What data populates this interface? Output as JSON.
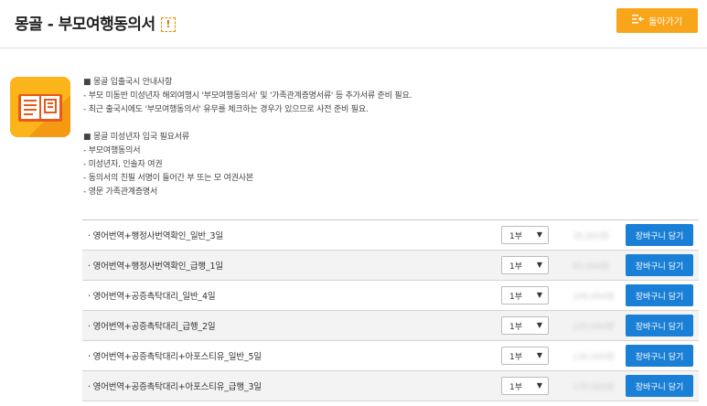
{
  "header": {
    "title": "몽골 - 부모여행동의서",
    "alert_symbol": "!",
    "back_button_label": "돌아가기"
  },
  "notice": {
    "lines_a": [
      "■ 몽골 입출국시 안내사항",
      "- 부모 미동반 미성년자 해외여행시 '부모여행동의서' 및 '가족관계증명서류' 등 추가서류 준비 필요.",
      "- 최근 출국시에도 '부모여행동의서' 유무를 체크하는 경우가 있으므로 사전 준비 필요."
    ],
    "lines_b": [
      "■ 몽골 미성년자 입국 필요서류",
      "- 부모여행동의서",
      "- 미성년자, 인솔자 여권",
      "- 동의서의 친필 서명이 들어간 부 또는 모 여권사본",
      "- 영문 가족관계증명서"
    ]
  },
  "products": [
    {
      "name": "· 영어번역+행정사번역확인_일반_3일",
      "qty": "1부",
      "price": "35,000원",
      "cart_label": "장바구니 담기"
    },
    {
      "name": "· 영어번역+행정사번역확인_급행_1일",
      "qty": "1부",
      "price": "45,000원",
      "cart_label": "장바구니 담기"
    },
    {
      "name": "· 영어번역+공증촉탁대리_일반_4일",
      "qty": "1부",
      "price": "100,000원",
      "cart_label": "장바구니 담기"
    },
    {
      "name": "· 영어번역+공증촉탁대리_급행_2일",
      "qty": "1부",
      "price": "120,000원",
      "cart_label": "장바구니 담기"
    },
    {
      "name": "· 영어번역+공증촉탁대리+아포스티유_일반_5일",
      "qty": "1부",
      "price": "130,000원",
      "cart_label": "장바구니 담기"
    },
    {
      "name": "· 영어번역+공증촉탁대리+아포스티유_급행_3일",
      "qty": "1부",
      "price": "170,000원",
      "cart_label": "장바구니 담기"
    }
  ],
  "colors": {
    "accent_orange": "#f9a51a",
    "cart_blue": "#1a7fd6"
  }
}
